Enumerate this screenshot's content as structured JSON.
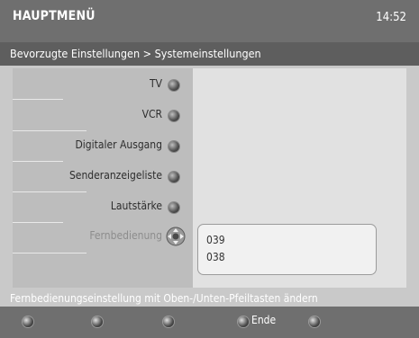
{
  "header": {
    "title": "HAUPTMENÜ",
    "time": "14:52"
  },
  "breadcrumb": "Bevorzugte Einstellungen > Systemeinstellungen",
  "menu": {
    "items": [
      {
        "label": "TV"
      },
      {
        "label": "VCR"
      },
      {
        "label": "Digitaler Ausgang"
      },
      {
        "label": "Senderanzeigeliste"
      },
      {
        "label": "Lautstärke"
      },
      {
        "label": "Fernbedienung"
      }
    ]
  },
  "options": {
    "values": [
      "039",
      "038"
    ]
  },
  "hint": "Fernbedienungseinstellung mit Oben-/Unten-Pfeiltasten ändern",
  "footer": {
    "keys": [
      {
        "label": ""
      },
      {
        "label": ""
      },
      {
        "label": ""
      },
      {
        "label": "Ende"
      },
      {
        "label": ""
      }
    ]
  },
  "colors": {
    "header": "#6f6f6f",
    "breadcrumb": "#5e5e5e",
    "menu": "#bdbdbd",
    "panel": "#e1e1e1"
  }
}
